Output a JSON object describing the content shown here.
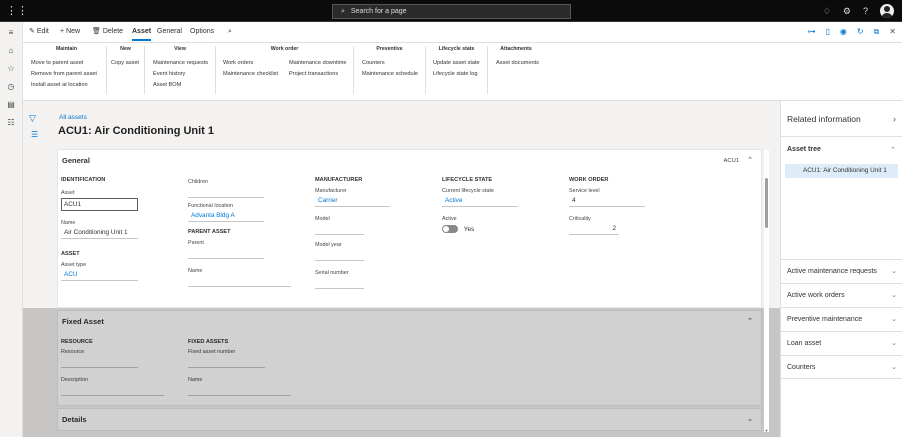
{
  "topbar": {
    "search_placeholder": "Search for a page"
  },
  "actionbar": {
    "edit": "Edit",
    "new": "New",
    "delete": "Delete",
    "tabs": [
      "Asset",
      "General",
      "Options"
    ]
  },
  "ribbon": {
    "groups": [
      {
        "title": "Maintain",
        "items": [
          "Move to parent asset",
          "Remove from parent asset",
          "Install asset at location"
        ]
      },
      {
        "title": "New",
        "items": [
          "Copy asset"
        ]
      },
      {
        "title": "View",
        "items": [
          "Maintenance requests",
          "Event history",
          "Asset BOM"
        ]
      },
      {
        "title": "Work order",
        "items_col1": [
          "Work orders",
          "Maintenance checklist"
        ],
        "items_col2": [
          "Maintenance downtime",
          "Project transactions"
        ]
      },
      {
        "title": "Preventive",
        "items": [
          "Counters",
          "Maintenance schedule"
        ]
      },
      {
        "title": "Lifecycle state",
        "items": [
          "Update asset state",
          "Lifecycle state log"
        ]
      },
      {
        "title": "Attachments",
        "items": [
          "Asset documents"
        ]
      }
    ]
  },
  "page": {
    "breadcrumb": "All assets",
    "title": "ACU1: Air Conditioning Unit 1"
  },
  "general": {
    "header": "General",
    "summary": "ACU1",
    "identification": {
      "heading": "IDENTIFICATION",
      "asset_label": "Asset",
      "asset_value": "ACU1",
      "name_label": "Name",
      "name_value": "Air Conditioning Unit 1"
    },
    "asset": {
      "heading": "ASSET",
      "type_label": "Asset type",
      "type_value": "ACU"
    },
    "children_label": "Children",
    "location": {
      "label": "Functional location",
      "value": "Advanta Bldg A"
    },
    "parent": {
      "heading": "PARENT ASSET",
      "parent_label": "Parent",
      "name_label": "Name"
    },
    "manufacturer": {
      "heading": "MANUFACTURER",
      "manufacturer_label": "Manufacturer",
      "manufacturer_value": "Carrier",
      "model_label": "Model",
      "model_year_label": "Model year",
      "serial_label": "Serial number"
    },
    "lifecycle": {
      "heading": "LIFECYCLE STATE",
      "current_label": "Current lifecycle state",
      "current_value": "Active",
      "active_label": "Active",
      "active_value": "Yes"
    },
    "workorder": {
      "heading": "WORK ORDER",
      "service_label": "Service level",
      "service_value": "4",
      "criticality_label": "Criticality",
      "criticality_value": "2"
    }
  },
  "fixed_asset": {
    "header": "Fixed Asset",
    "resource": {
      "heading": "RESOURCE",
      "resource_label": "Resource",
      "description_label": "Description"
    },
    "fixed_assets": {
      "heading": "FIXED ASSETS",
      "number_label": "Fixed asset number",
      "name_label": "Name"
    }
  },
  "details": {
    "header": "Details"
  },
  "related": {
    "title": "Related information",
    "asset_tree": {
      "heading": "Asset tree",
      "item": "ACU1: Air Conditioning Unit 1"
    },
    "sections": [
      "Active maintenance requests",
      "Active work orders",
      "Preventive maintenance",
      "Loan asset",
      "Counters"
    ]
  }
}
